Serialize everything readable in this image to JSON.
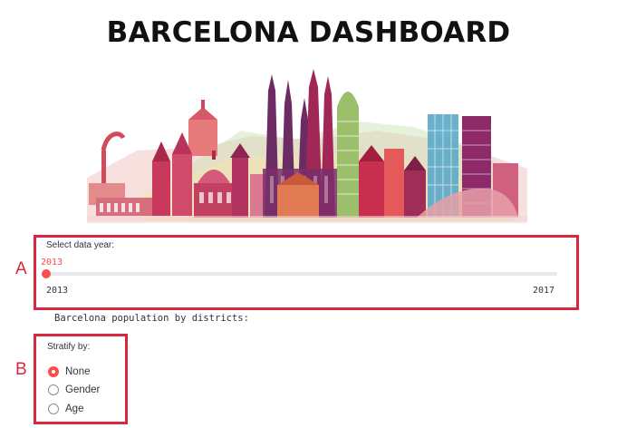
{
  "page_title": "BARCELONA DASHBOARD",
  "skyline_image": {
    "icon": "barcelona-skyline-illustration"
  },
  "annotations": {
    "a": "A",
    "b": "B"
  },
  "slider": {
    "label": "Select data year:",
    "current_value": "2013",
    "min_label": "2013",
    "max_label": "2017",
    "min": 2013,
    "max": 2017,
    "value": 2013
  },
  "population_text": "Barcelona population by districts:",
  "stratify": {
    "label": "Stratify by:",
    "options": [
      {
        "label": "None",
        "selected": true
      },
      {
        "label": "Gender",
        "selected": false
      },
      {
        "label": "Age",
        "selected": false
      }
    ]
  },
  "colors": {
    "accent": "#ff4b4b",
    "annotation": "#d7263d",
    "text": "#31333f"
  }
}
